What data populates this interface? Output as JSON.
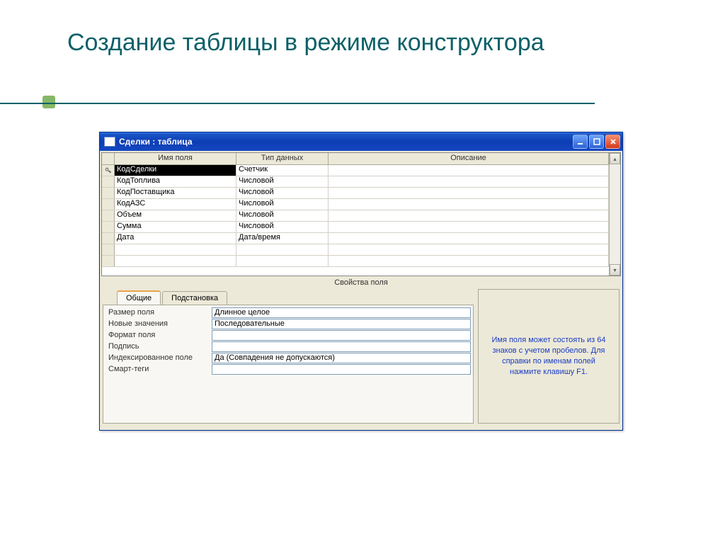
{
  "slide": {
    "title": "Создание таблицы в режиме конструктора"
  },
  "window": {
    "title": "Сделки : таблица"
  },
  "grid": {
    "headers": {
      "name": "Имя поля",
      "type": "Тип данных",
      "desc": "Описание"
    },
    "rows": [
      {
        "key": true,
        "selected": true,
        "name": "КодСделки",
        "type": "Счетчик"
      },
      {
        "key": false,
        "selected": false,
        "name": "КодТоплива",
        "type": "Числовой"
      },
      {
        "key": false,
        "selected": false,
        "name": "КодПоставщика",
        "type": "Числовой"
      },
      {
        "key": false,
        "selected": false,
        "name": "КодАЗС",
        "type": "Числовой"
      },
      {
        "key": false,
        "selected": false,
        "name": "Объем",
        "type": "Числовой"
      },
      {
        "key": false,
        "selected": false,
        "name": "Сумма",
        "type": "Числовой"
      },
      {
        "key": false,
        "selected": false,
        "name": "Дата",
        "type": "Дата/время"
      },
      {
        "key": false,
        "selected": false,
        "name": "",
        "type": ""
      },
      {
        "key": false,
        "selected": false,
        "name": "",
        "type": ""
      }
    ]
  },
  "props": {
    "section_label": "Свойства поля",
    "tab_general": "Общие",
    "tab_lookup": "Подстановка",
    "rows": [
      {
        "label": "Размер поля",
        "value": "Длинное целое"
      },
      {
        "label": "Новые значения",
        "value": "Последовательные"
      },
      {
        "label": "Формат поля",
        "value": ""
      },
      {
        "label": "Подпись",
        "value": ""
      },
      {
        "label": "Индексированное поле",
        "value": "Да (Совпадения не допускаются)"
      },
      {
        "label": "Смарт-теги",
        "value": ""
      }
    ],
    "help_text": "Имя поля может состоять из 64 знаков с учетом пробелов.  Для справки по именам полей нажмите клавишу F1."
  }
}
